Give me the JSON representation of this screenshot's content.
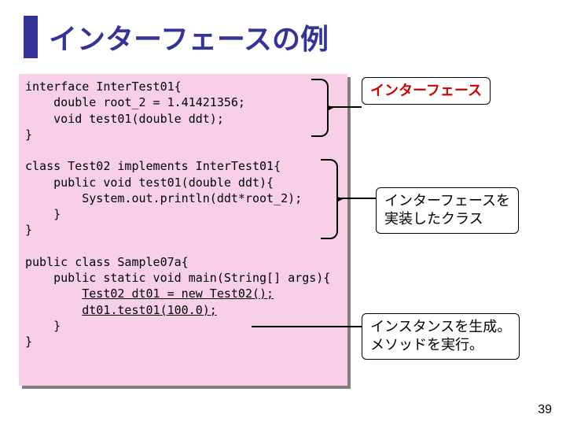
{
  "title": "インターフェースの例",
  "code": {
    "l1": "interface InterTest01{",
    "l2": "    double root_2 = 1.41421356;",
    "l3": "    void test01(double ddt);",
    "l4": "}",
    "l5": "",
    "l6": "class Test02 implements InterTest01{",
    "l7": "    public void test01(double ddt){",
    "l8": "        System.out.println(ddt*root_2);",
    "l9": "    }",
    "l10": "}",
    "l11": "",
    "l12": "public class Sample07a{",
    "l13": "    public static void main(String[] args){",
    "l14a": "        ",
    "l14b": "Test02 dt01 = new Test02();",
    "l15a": "        ",
    "l15b": "dt01.test01(100.0);",
    "l16": "    }",
    "l17": "}"
  },
  "labels": {
    "l1": "インターフェース",
    "l2": "インターフェースを\n実装したクラス",
    "l3": "インスタンスを生成。\nメソッドを実行。"
  },
  "page": "39"
}
